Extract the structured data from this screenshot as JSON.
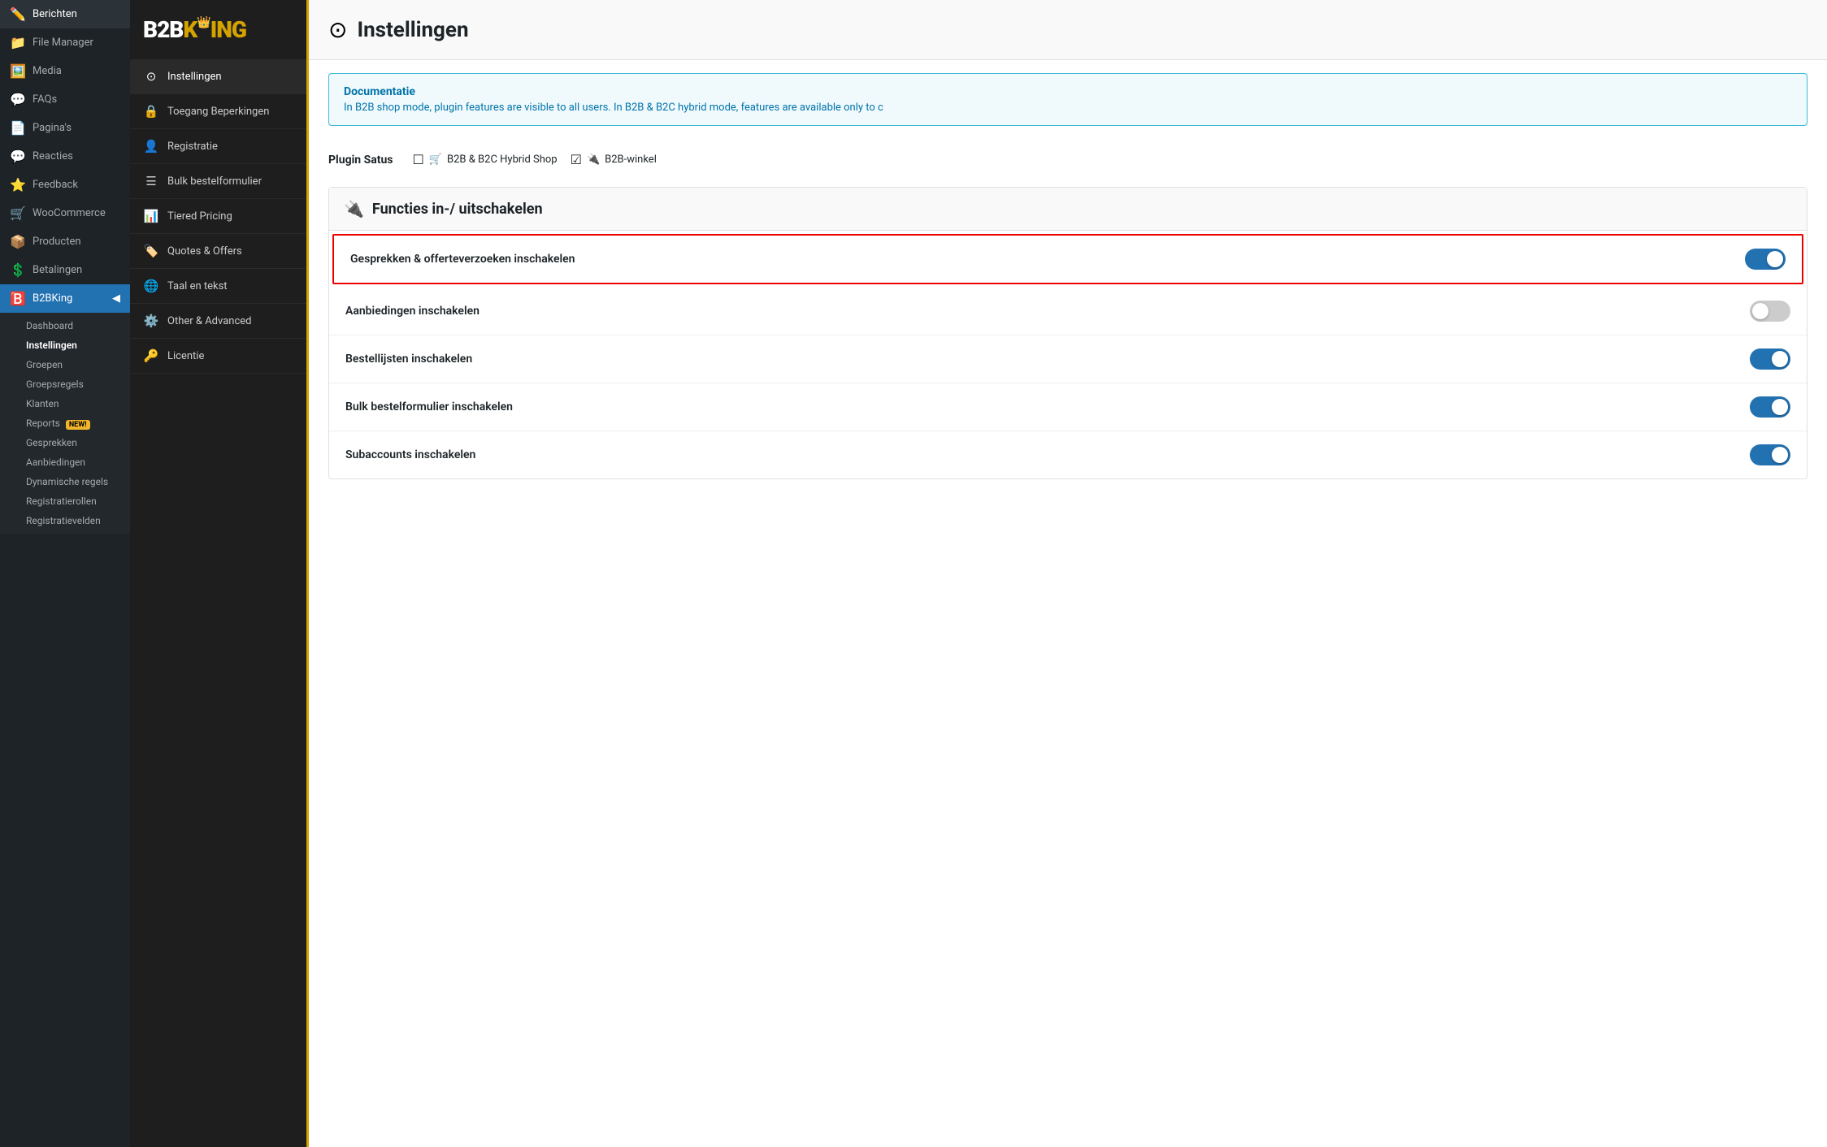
{
  "wp_sidebar": {
    "items": [
      {
        "id": "berichten",
        "label": "Berichten",
        "icon": "✏️"
      },
      {
        "id": "file-manager",
        "label": "File Manager",
        "icon": "📁"
      },
      {
        "id": "media",
        "label": "Media",
        "icon": "🖼️"
      },
      {
        "id": "faqs",
        "label": "FAQs",
        "icon": "💬"
      },
      {
        "id": "paginas",
        "label": "Pagina's",
        "icon": "📄"
      },
      {
        "id": "reacties",
        "label": "Reacties",
        "icon": "💬"
      },
      {
        "id": "feedback",
        "label": "Feedback",
        "icon": "⭐"
      },
      {
        "id": "woocommerce",
        "label": "WooCommerce",
        "icon": "🛒"
      },
      {
        "id": "producten",
        "label": "Producten",
        "icon": "📦"
      },
      {
        "id": "betalingen",
        "label": "Betalingen",
        "icon": "💲"
      },
      {
        "id": "b2bking",
        "label": "B2BKing",
        "icon": "🅱️",
        "active": true
      }
    ],
    "submenu": [
      {
        "id": "dashboard",
        "label": "Dashboard"
      },
      {
        "id": "instellingen",
        "label": "Instellingen",
        "active": true
      },
      {
        "id": "groepen",
        "label": "Groepen"
      },
      {
        "id": "groepsregels",
        "label": "Groepsregels"
      },
      {
        "id": "klanten",
        "label": "Klanten"
      },
      {
        "id": "reports",
        "label": "Reports",
        "badge": "NEW!"
      },
      {
        "id": "gesprekken",
        "label": "Gesprekken"
      },
      {
        "id": "aanbiedingen",
        "label": "Aanbiedingen"
      },
      {
        "id": "dynamische-regels",
        "label": "Dynamische regels"
      },
      {
        "id": "registratierollen",
        "label": "Registratierollen"
      },
      {
        "id": "registratievelden",
        "label": "Registratievelden"
      }
    ]
  },
  "plugin_sidebar": {
    "logo": "B2BKing",
    "nav_items": [
      {
        "id": "instellingen",
        "label": "Instellingen",
        "icon": "⊙",
        "active": true
      },
      {
        "id": "toegang-beperkingen",
        "label": "Toegang Beperkingen",
        "icon": "🔒"
      },
      {
        "id": "registratie",
        "label": "Registratie",
        "icon": "👤"
      },
      {
        "id": "bulk-bestelformulier",
        "label": "Bulk bestelformulier",
        "icon": "☰"
      },
      {
        "id": "tiered-pricing",
        "label": "Tiered Pricing",
        "icon": "📊"
      },
      {
        "id": "quotes-offers",
        "label": "Quotes & Offers",
        "icon": "🏷️"
      },
      {
        "id": "taal-en-tekst",
        "label": "Taal en tekst",
        "icon": "🌐"
      },
      {
        "id": "other-advanced",
        "label": "Other & Advanced",
        "icon": "⚙️"
      },
      {
        "id": "licentie",
        "label": "Licentie",
        "icon": "🔑"
      }
    ]
  },
  "page": {
    "title": "Instellingen",
    "header_icon": "⊙",
    "documentation": {
      "title": "Documentatie",
      "text": "In B2B shop mode, plugin features are visible to all users. In B2B & B2C hybrid mode, features are available only to c"
    },
    "plugin_status": {
      "label": "Plugin Satus",
      "options": [
        {
          "id": "b2b-b2c",
          "label": "B2B & B2C Hybrid Shop",
          "checked": false,
          "icon": "🛒"
        },
        {
          "id": "b2b-winkel",
          "label": "B2B-winkel",
          "checked": true,
          "icon": "🔌"
        }
      ]
    },
    "features_section": {
      "title": "Functies in-/ uitschakelen",
      "icon": "🔌",
      "features": [
        {
          "id": "gesprekken-offerteverzoeken",
          "label": "Gesprekken & offerteverzoeken inschakelen",
          "enabled": true,
          "highlighted": true
        },
        {
          "id": "aanbiedingen",
          "label": "Aanbiedingen inschakelen",
          "enabled": false,
          "highlighted": false
        },
        {
          "id": "bestellijsten",
          "label": "Bestellijsten inschakelen",
          "enabled": true,
          "highlighted": false
        },
        {
          "id": "bulk-bestelformulier",
          "label": "Bulk bestelformulier inschakelen",
          "enabled": true,
          "highlighted": false
        },
        {
          "id": "subaccounts",
          "label": "Subaccounts inschakelen",
          "enabled": true,
          "highlighted": false
        }
      ]
    }
  }
}
